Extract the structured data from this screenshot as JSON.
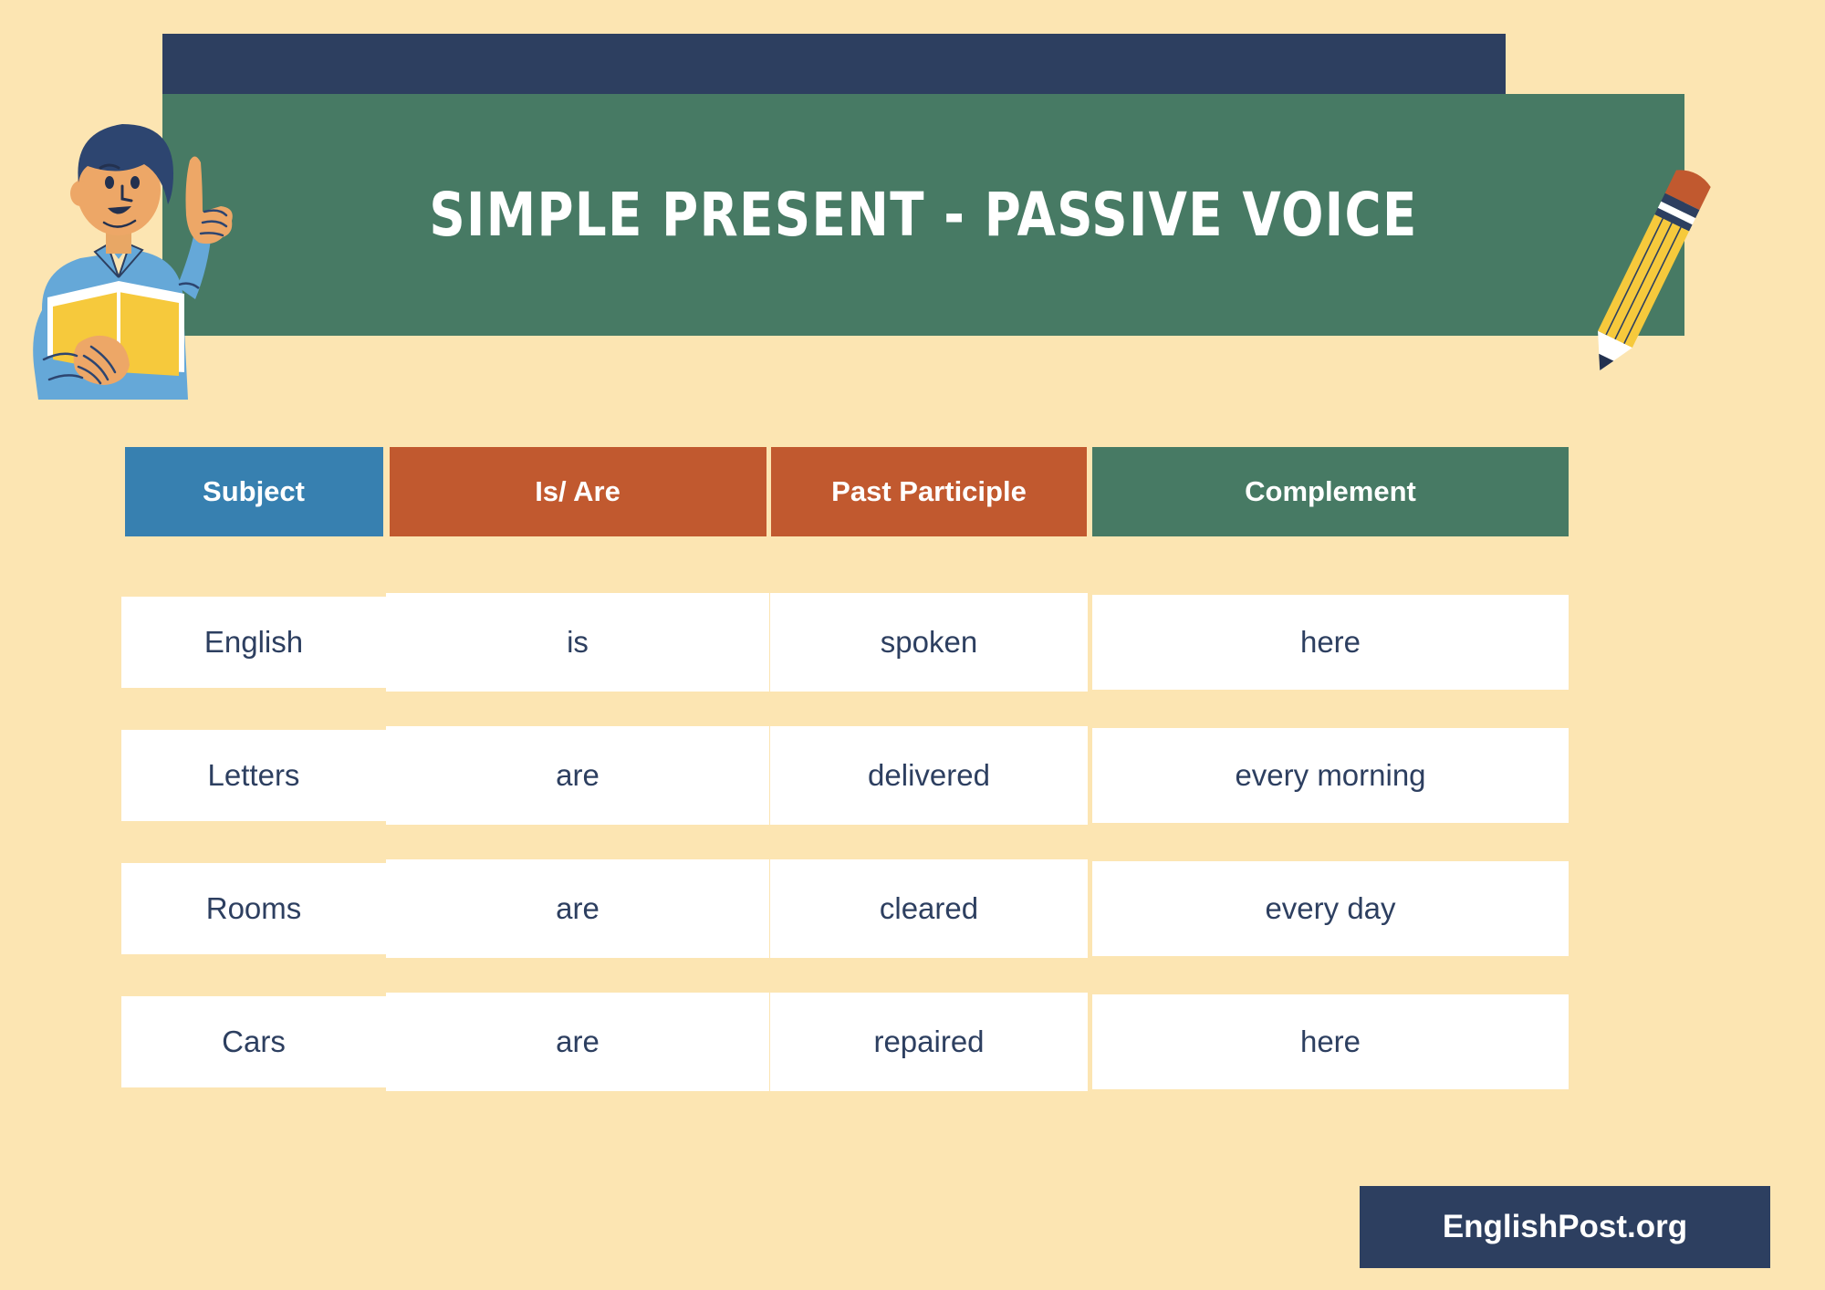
{
  "header": {
    "title": "SIMPLE PRESENT - PASSIVE VOICE"
  },
  "colors": {
    "background": "#fce5b2",
    "board_frame": "#2d3f60",
    "board_face": "#477a64",
    "header_subject": "#3780b0",
    "header_isare": "#c1592f",
    "header_participle": "#c1592f",
    "header_complement": "#477a64",
    "cell_background": "#ffffff",
    "cell_text": "#2d3f60",
    "footer_badge": "#2d3f60"
  },
  "table": {
    "headers": [
      {
        "label": "Subject"
      },
      {
        "label": "Is/ Are"
      },
      {
        "label": "Past Participle"
      },
      {
        "label": "Complement"
      }
    ],
    "rows": [
      {
        "subject": "English",
        "isare": "is",
        "participle": "spoken",
        "complement": "here"
      },
      {
        "subject": "Letters",
        "isare": "are",
        "participle": "delivered",
        "complement": "every morning"
      },
      {
        "subject": "Rooms",
        "isare": "are",
        "participle": "cleared",
        "complement": "every day"
      },
      {
        "subject": "Cars",
        "isare": "are",
        "participle": "repaired",
        "complement": "here"
      }
    ]
  },
  "footer": {
    "brand": "EnglishPost.org"
  },
  "illustrations": {
    "reader": "reading-man-illustration",
    "pencil": "pencil-illustration"
  }
}
